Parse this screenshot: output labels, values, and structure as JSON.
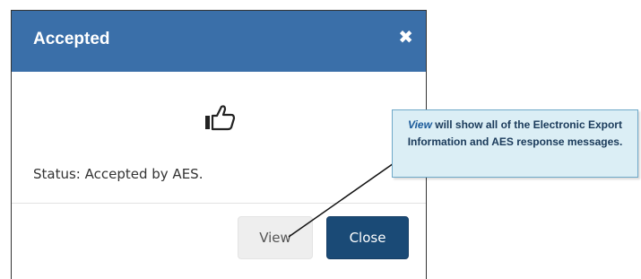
{
  "modal": {
    "title": "Accepted",
    "close_icon_glyph": "✖",
    "status_text": "Status: Accepted by AES.",
    "buttons": {
      "view_label": "View",
      "close_label": "Close"
    },
    "icons": [
      "thumbs-up-icon",
      "close-icon"
    ]
  },
  "callout": {
    "lead": "View",
    "text": " will show all of the Electronic Export Information and AES response messages."
  },
  "colors": {
    "header": "#3a6fa9",
    "close_button": "#1a4a76",
    "view_button": "#eeeeee",
    "callout_bg": "#dbeef5",
    "callout_border": "#6fa9c9"
  }
}
